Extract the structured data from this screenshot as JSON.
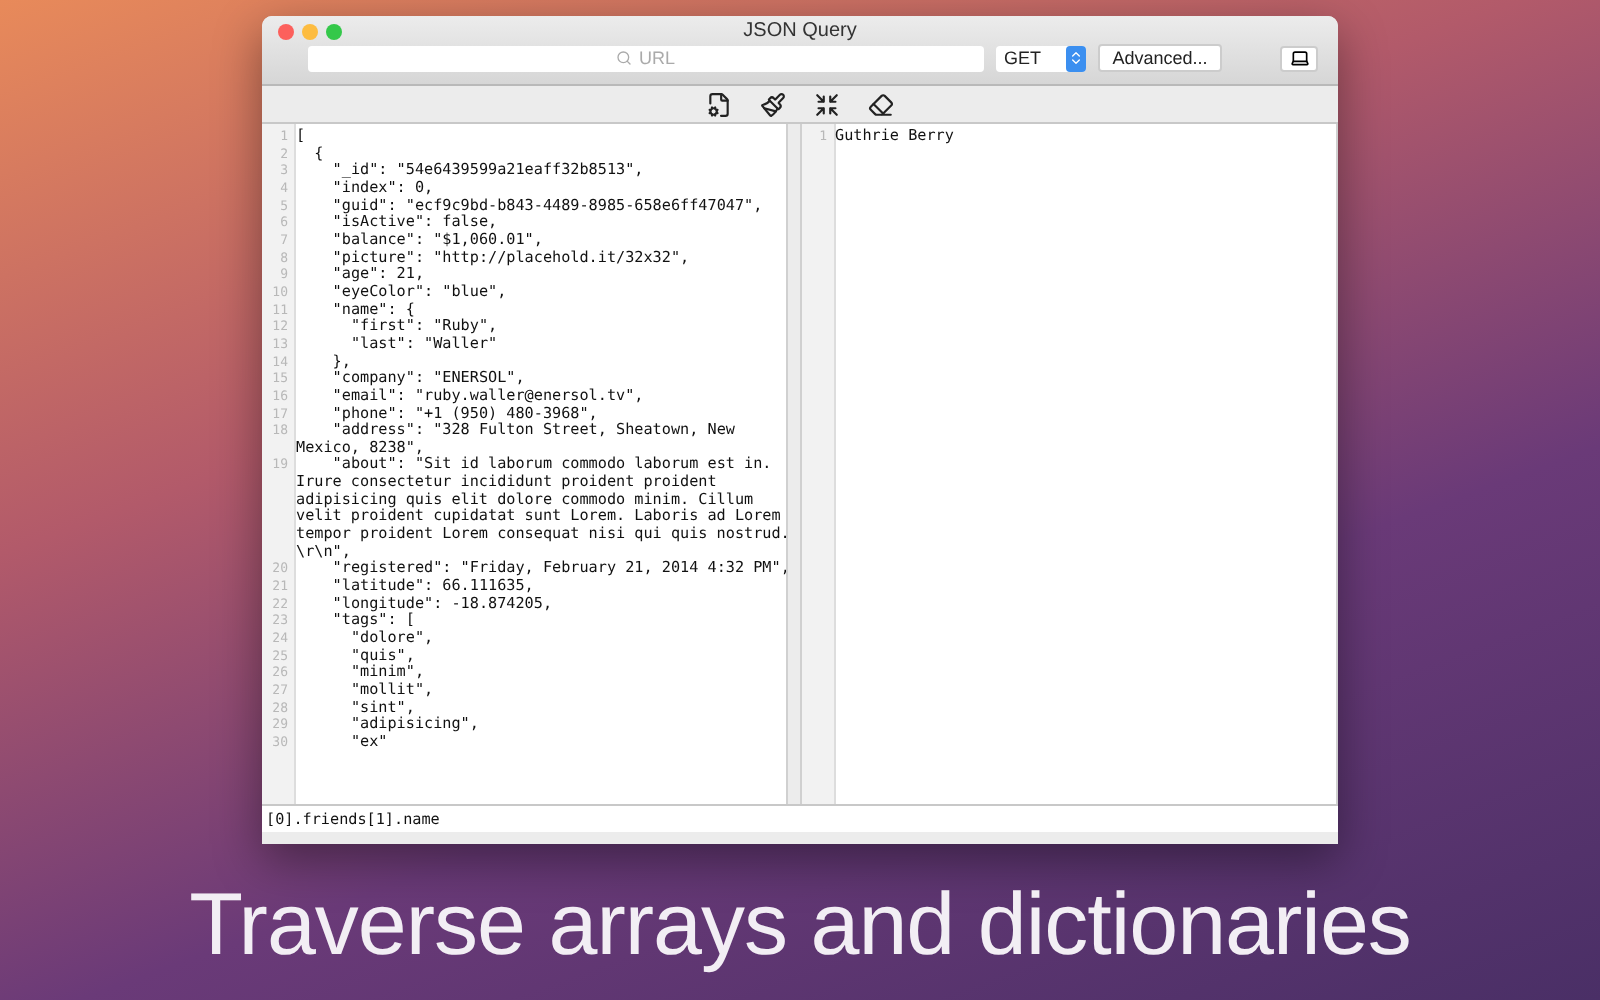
{
  "window": {
    "title": "JSON Query"
  },
  "url_bar": {
    "placeholder": "URL",
    "method": "GET",
    "advanced_button": "Advanced..."
  },
  "input_lines": [
    {
      "number": "1",
      "text": "["
    },
    {
      "number": "2",
      "text": "  {"
    },
    {
      "number": "3",
      "text": "    \"_id\": \"54e6439599a21eaff32b8513\","
    },
    {
      "number": "4",
      "text": "    \"index\": 0,"
    },
    {
      "number": "5",
      "text": "    \"guid\": \"ecf9c9bd-b843-4489-8985-658e6ff47047\","
    },
    {
      "number": "6",
      "text": "    \"isActive\": false,"
    },
    {
      "number": "7",
      "text": "    \"balance\": \"$1,060.01\","
    },
    {
      "number": "8",
      "text": "    \"picture\": \"http://placehold.it/32x32\","
    },
    {
      "number": "9",
      "text": "    \"age\": 21,"
    },
    {
      "number": "10",
      "text": "    \"eyeColor\": \"blue\","
    },
    {
      "number": "11",
      "text": "    \"name\": {"
    },
    {
      "number": "12",
      "text": "      \"first\": \"Ruby\","
    },
    {
      "number": "13",
      "text": "      \"last\": \"Waller\""
    },
    {
      "number": "14",
      "text": "    },"
    },
    {
      "number": "15",
      "text": "    \"company\": \"ENERSOL\","
    },
    {
      "number": "16",
      "text": "    \"email\": \"ruby.waller@enersol.tv\","
    },
    {
      "number": "17",
      "text": "    \"phone\": \"+1 (950) 480-3968\","
    },
    {
      "number": "18",
      "text": "    \"address\": \"328 Fulton Street, Sheatown, New Mexico, 8238\","
    },
    {
      "number": "19",
      "text": "    \"about\": \"Sit id laborum commodo laborum est in. Irure consectetur incididunt proident proident adipisicing quis elit dolore commodo minim. Cillum velit proident cupidatat sunt Lorem. Laboris ad Lorem tempor proident Lorem consequat nisi qui quis nostrud. \\r\\n\","
    },
    {
      "number": "20",
      "text": "    \"registered\": \"Friday, February 21, 2014 4:32 PM\","
    },
    {
      "number": "21",
      "text": "    \"latitude\": 66.111635,"
    },
    {
      "number": "22",
      "text": "    \"longitude\": -18.874205,"
    },
    {
      "number": "23",
      "text": "    \"tags\": ["
    },
    {
      "number": "24",
      "text": "      \"dolore\","
    },
    {
      "number": "25",
      "text": "      \"quis\","
    },
    {
      "number": "26",
      "text": "      \"minim\","
    },
    {
      "number": "27",
      "text": "      \"mollit\","
    },
    {
      "number": "28",
      "text": "      \"sint\","
    },
    {
      "number": "29",
      "text": "      \"adipisicing\","
    },
    {
      "number": "30",
      "text": "      \"ex\""
    }
  ],
  "output_lines": [
    {
      "number": "1",
      "text": "Guthrie Berry"
    }
  ],
  "query": "[0].friends[1].name",
  "caption": "Traverse arrays and dictionaries"
}
